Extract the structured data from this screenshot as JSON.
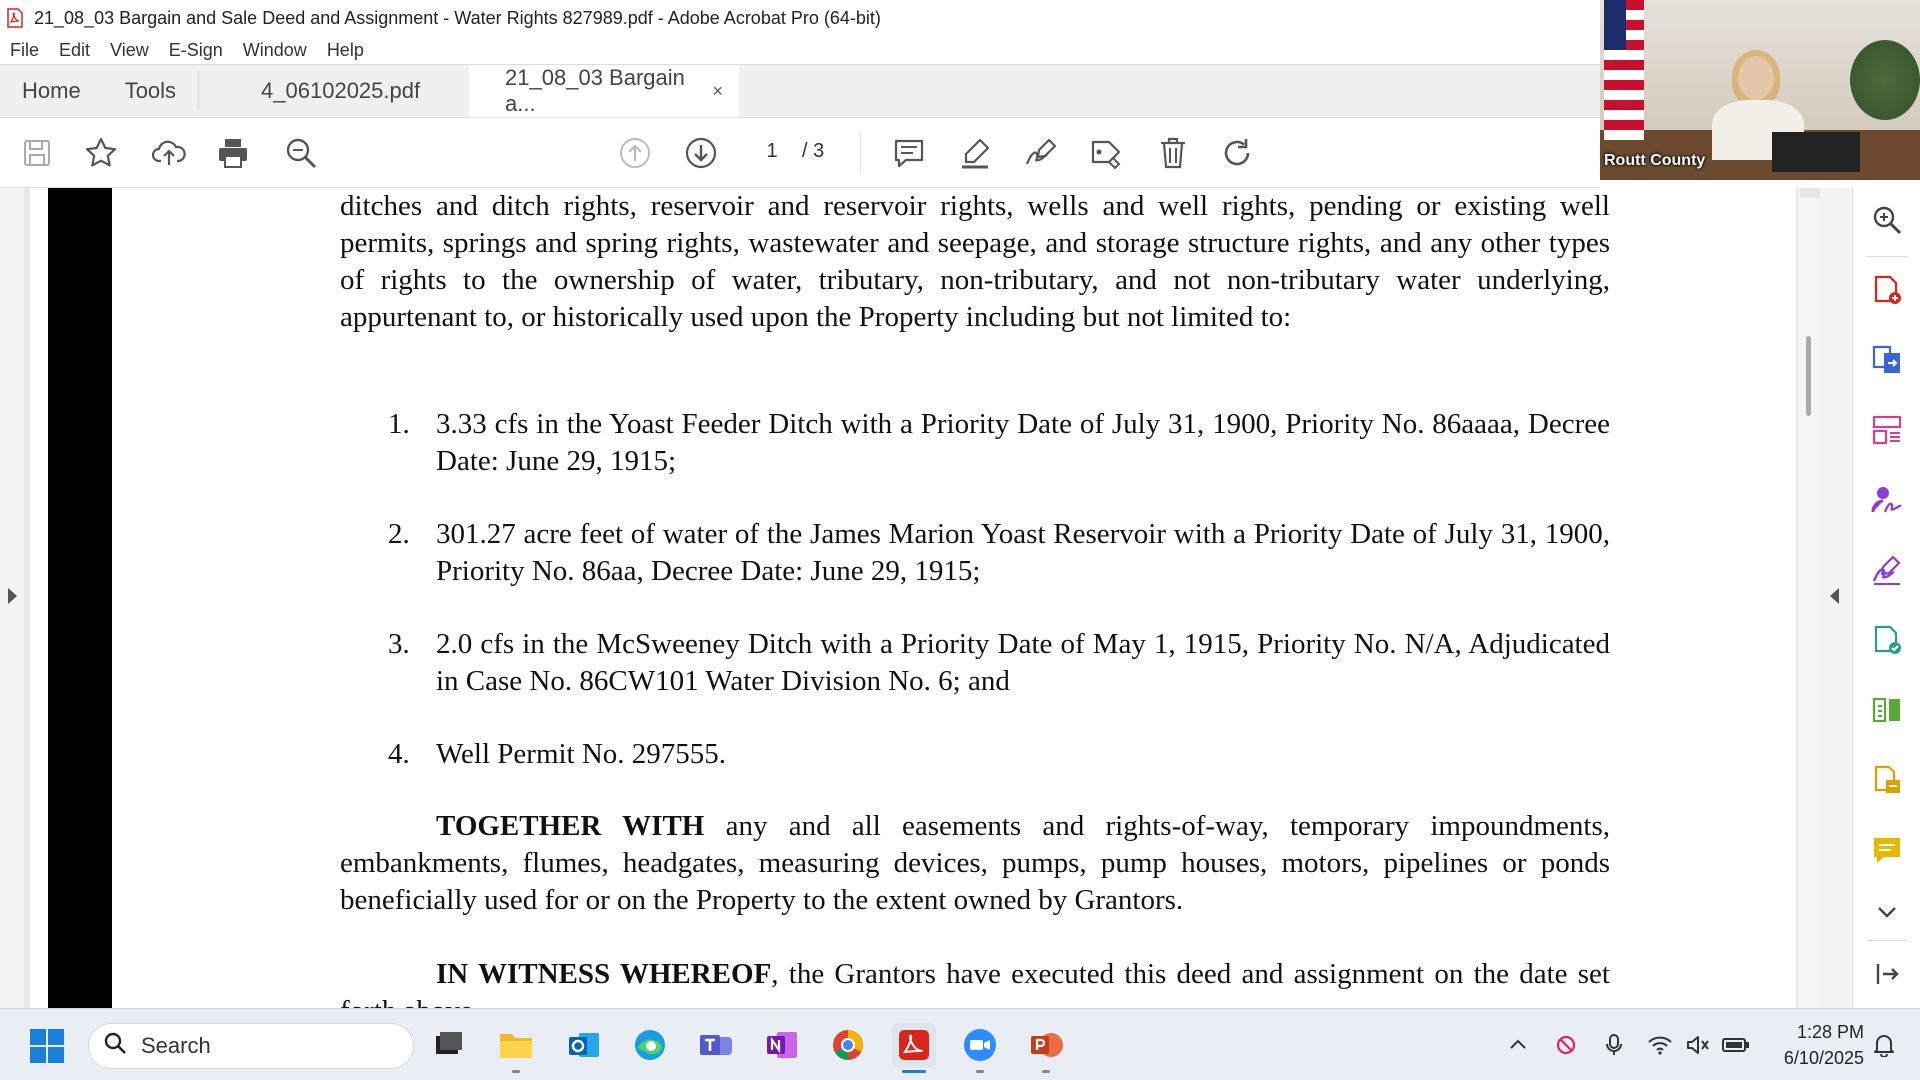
{
  "window": {
    "title": "21_08_03 Bargain and Sale Deed and Assignment - Water Rights 827989.pdf - Adobe Acrobat Pro (64-bit)"
  },
  "menu": [
    "File",
    "Edit",
    "View",
    "E-Sign",
    "Window",
    "Help"
  ],
  "tabs": {
    "home": "Home",
    "tools": "Tools",
    "doc1": "4_06102025.pdf",
    "doc2": "21_08_03 Bargain a...",
    "close_glyph": "×"
  },
  "toolbar": {
    "page_current": "1",
    "page_total": "/ 3"
  },
  "document": {
    "para_intro": "ditches and ditch rights, reservoir and reservoir rights, wells and well rights, pending or existing well permits, springs and spring rights, wastewater and seepage, and storage structure rights, and any other types of rights to the ownership of water, tributary, non-tributary, and not non-tributary water underlying, appurtenant to, or historically used upon the Property including but not limited to:",
    "items": [
      {
        "num": "1.",
        "text": "3.33 cfs in the Yoast Feeder Ditch with a Priority Date of July 31, 1900, Priority No. 86aaaa, Decree Date: June 29, 1915;"
      },
      {
        "num": "2.",
        "text": "301.27 acre feet of water of the James Marion Yoast Reservoir with a Priority Date of July 31, 1900, Priority No. 86aa, Decree Date: June 29, 1915;"
      },
      {
        "num": "3.",
        "text": "2.0 cfs in the McSweeney Ditch with a Priority Date of May 1, 1915, Priority No. N/A, Adjudicated in Case No. 86CW101 Water Division No. 6; and"
      },
      {
        "num": "4.",
        "text": "Well Permit No. 297555."
      }
    ],
    "together_bold": "TOGETHER WITH",
    "together_rest": " any and all easements and rights-of-way, temporary impoundments, embankments, flumes, headgates, measuring devices, pumps, pump houses, motors, pipelines or ponds beneficially used for or on the Property to the extent owned by Grantors.",
    "witness_bold": "IN WITNESS WHEREOF",
    "witness_rest": ", the Grantors have executed this deed and assignment on the date set forth above."
  },
  "video": {
    "label": "Routt County"
  },
  "taskbar": {
    "search_label": "Search",
    "time": "1:28 PM",
    "date": "6/10/2025"
  },
  "colors": {
    "accent": "#1a7fd8",
    "acrobat_red": "#d7261e",
    "acrobat_icon_purple": "#8c3bd6"
  }
}
